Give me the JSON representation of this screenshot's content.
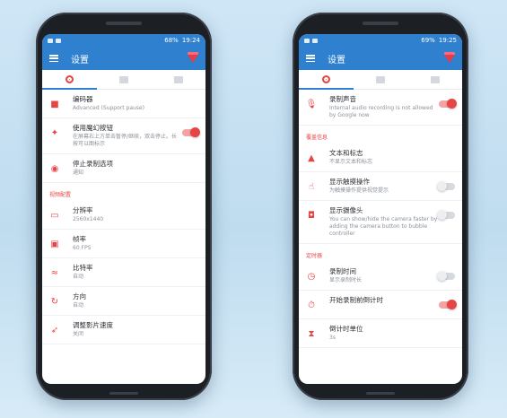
{
  "colors": {
    "appbar": "#2f80cf",
    "accent": "#e64545"
  },
  "left_phone": {
    "status": {
      "battery": "68%",
      "time": "19:24"
    },
    "appbar_title": "设置",
    "rows_top": [
      {
        "icon": "video-camera-icon",
        "title": "编码器",
        "subtitle": "Advanced (Support pause)"
      },
      {
        "icon": "magic-wand-icon",
        "title": "使用魔幻按钮",
        "subtitle": "在屏幕右上方单击暂停/继续，双击停止。长按可以图标示",
        "toggle": true
      },
      {
        "icon": "stop-circle-icon",
        "title": "停止录制选项",
        "subtitle": "通知"
      }
    ],
    "section_label": "视频配置",
    "rows_bottom": [
      {
        "icon": "resolution-icon",
        "title": "分辨率",
        "subtitle": "2560x1440"
      },
      {
        "icon": "frame-rate-icon",
        "title": "帧率",
        "subtitle": "60 FPS"
      },
      {
        "icon": "bitrate-wave-icon",
        "title": "比特率",
        "subtitle": "自动"
      },
      {
        "icon": "orientation-icon",
        "title": "方向",
        "subtitle": "自动"
      },
      {
        "icon": "speed-icon",
        "title": "调整影片速度",
        "subtitle": "关闭"
      }
    ]
  },
  "right_phone": {
    "status": {
      "battery": "69%",
      "time": "19:25"
    },
    "appbar_title": "设置",
    "row_audio": {
      "icon": "microphone-icon",
      "title": "录制声音",
      "subtitle": "Internal audio recording is not allowed by Google now",
      "toggle": true
    },
    "section_overlay": "覆盖信息",
    "rows_overlay": [
      {
        "icon": "text-logo-icon",
        "title": "文本和标志",
        "subtitle": "不显示文本和标志"
      },
      {
        "icon": "touch-icon",
        "title": "显示触摸操作",
        "subtitle": "为触摸操作提供视觉提示",
        "toggle": false
      },
      {
        "icon": "camera-icon",
        "title": "显示摄像头",
        "subtitle": "You can show/hide the camera faster by adding the camera button to bubble controller",
        "toggle": false
      }
    ],
    "section_timer": "定时器",
    "rows_timer": [
      {
        "icon": "clock-icon",
        "title": "录制时间",
        "subtitle": "显示录制时长",
        "toggle": false
      },
      {
        "icon": "countdown-icon",
        "title": "开始录制前倒计时",
        "subtitle": "",
        "toggle": true
      },
      {
        "icon": "hourglass-icon",
        "title": "倒计时单位",
        "subtitle": "3s"
      }
    ]
  }
}
